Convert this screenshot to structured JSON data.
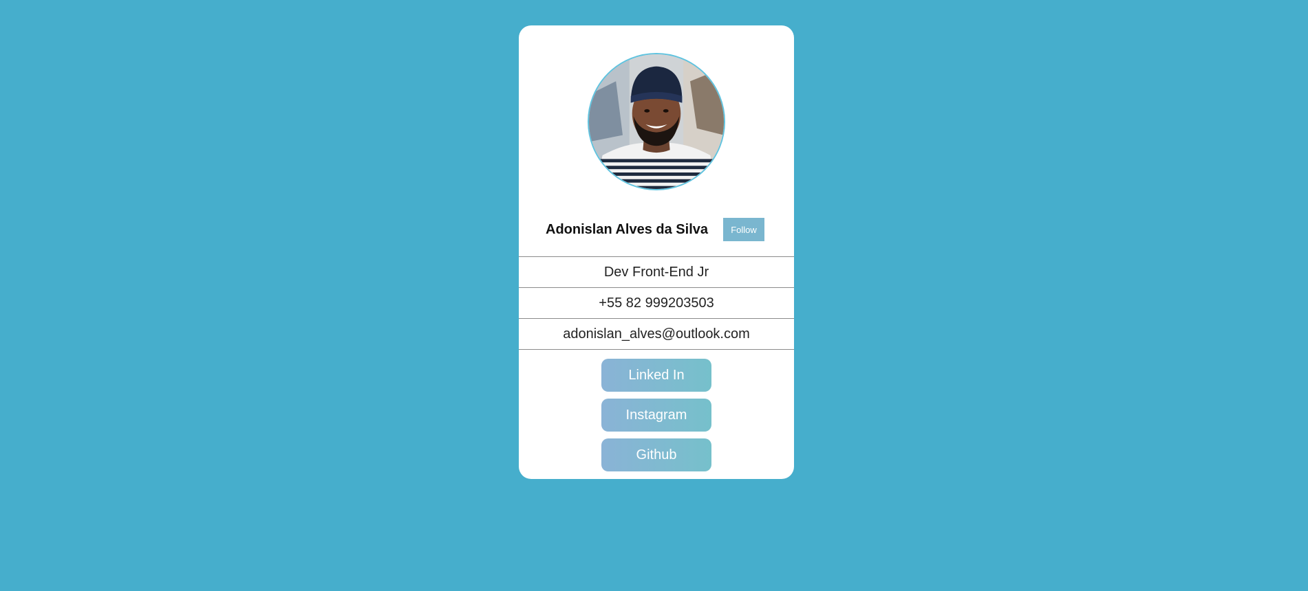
{
  "profile": {
    "name": "Adonislan Alves da Silva",
    "follow_label": "Follow",
    "avatar_icon": "avatar-photo"
  },
  "info": {
    "role": "Dev Front-End Jr",
    "phone": "+55 82 999203503",
    "email": "adonislan_alves@outlook.com"
  },
  "links": [
    {
      "label": "Linked In"
    },
    {
      "label": "Instagram"
    },
    {
      "label": "Github"
    }
  ],
  "colors": {
    "background": "#46aecc",
    "card": "#ffffff",
    "follow_button": "#7ab6cf",
    "link_gradient_start": "#8ab3d6",
    "link_gradient_end": "#76c0cb",
    "avatar_border": "#5fc3df"
  }
}
